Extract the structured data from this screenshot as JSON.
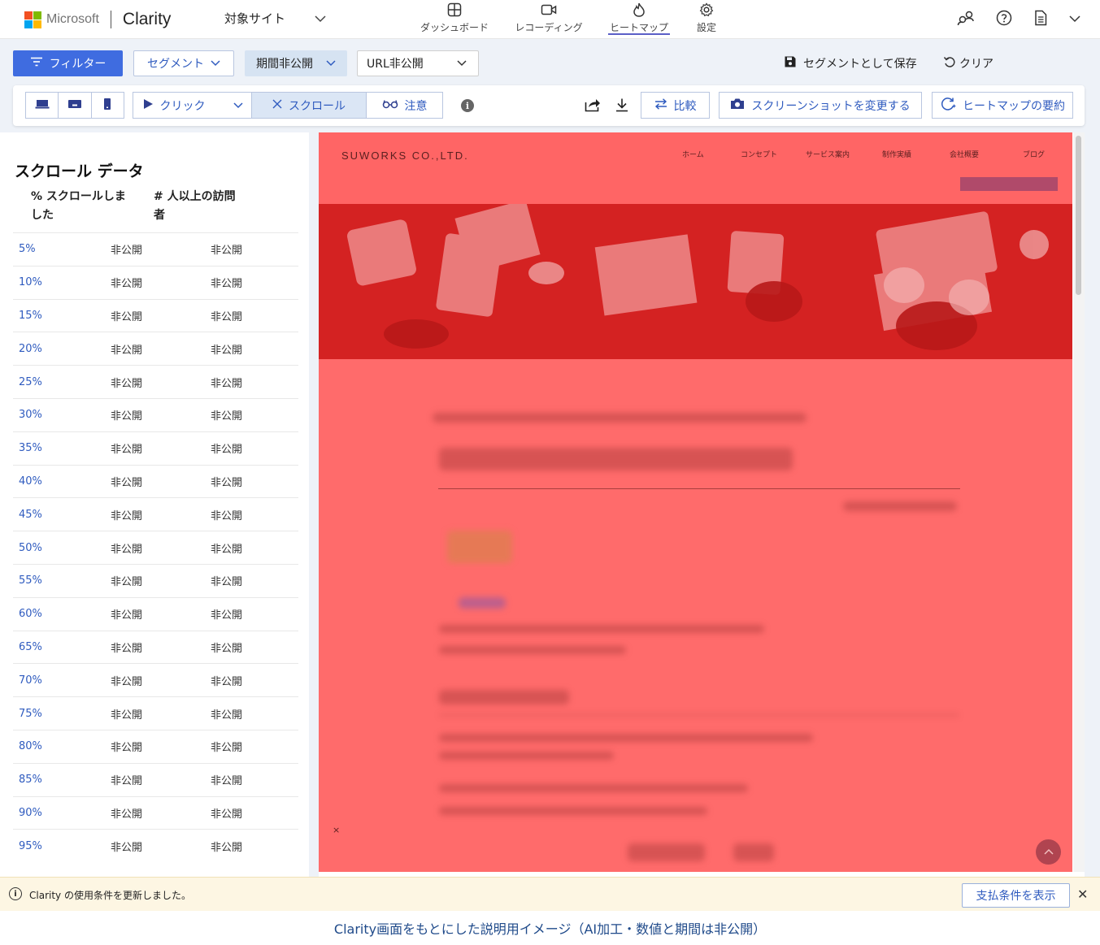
{
  "header": {
    "brand": "Microsoft",
    "product": "Clarity",
    "site_select": "対象サイト",
    "nav": [
      {
        "label": "ダッシュボード",
        "icon": "dashboard-icon"
      },
      {
        "label": "レコーディング",
        "icon": "video-icon"
      },
      {
        "label": "ヒートマップ",
        "icon": "flame-icon",
        "active": true
      },
      {
        "label": "設定",
        "icon": "gear-icon"
      }
    ]
  },
  "filters": {
    "filter_label": "フィルター",
    "segment_label": "セグメント",
    "period_label": "期間非公開",
    "url_label": "URL非公開",
    "save_segment": "セグメントとして保存",
    "clear": "クリア"
  },
  "toolbar": {
    "click": "クリック",
    "scroll": "スクロール",
    "attention": "注意",
    "compare": "比較",
    "change_screenshot": "スクリーンショットを変更する",
    "summary": "ヒートマップの要約"
  },
  "scroll_panel": {
    "title": "スクロール データ",
    "col1": "% スクロールしました",
    "col2": "# 人以上の訪問者",
    "rows": [
      {
        "pct": "5%",
        "a": "非公開",
        "b": "非公開"
      },
      {
        "pct": "10%",
        "a": "非公開",
        "b": "非公開"
      },
      {
        "pct": "15%",
        "a": "非公開",
        "b": "非公開"
      },
      {
        "pct": "20%",
        "a": "非公開",
        "b": "非公開"
      },
      {
        "pct": "25%",
        "a": "非公開",
        "b": "非公開"
      },
      {
        "pct": "30%",
        "a": "非公開",
        "b": "非公開"
      },
      {
        "pct": "35%",
        "a": "非公開",
        "b": "非公開"
      },
      {
        "pct": "40%",
        "a": "非公開",
        "b": "非公開"
      },
      {
        "pct": "45%",
        "a": "非公開",
        "b": "非公開"
      },
      {
        "pct": "50%",
        "a": "非公開",
        "b": "非公開"
      },
      {
        "pct": "55%",
        "a": "非公開",
        "b": "非公開"
      },
      {
        "pct": "60%",
        "a": "非公開",
        "b": "非公開"
      },
      {
        "pct": "65%",
        "a": "非公開",
        "b": "非公開"
      },
      {
        "pct": "70%",
        "a": "非公開",
        "b": "非公開"
      },
      {
        "pct": "75%",
        "a": "非公開",
        "b": "非公開"
      },
      {
        "pct": "80%",
        "a": "非公開",
        "b": "非公開"
      },
      {
        "pct": "85%",
        "a": "非公開",
        "b": "非公開"
      },
      {
        "pct": "90%",
        "a": "非公開",
        "b": "非公開"
      },
      {
        "pct": "95%",
        "a": "非公開",
        "b": "非公開"
      }
    ]
  },
  "preview": {
    "logo": "SUWORKS CO.,LTD.",
    "nav": [
      "ホーム",
      "コンセプト",
      "サービス案内",
      "制作実績",
      "会社概要",
      "ブログ"
    ],
    "close_mark": "×",
    "heat_color": "#ff6b6b"
  },
  "notice": {
    "text": "Clarity の使用条件を更新しました。",
    "button": "支払条件を表示"
  },
  "caption": "Clarity画面をもとにした説明用イメージ（AI加工・数値と期間は非公開）"
}
